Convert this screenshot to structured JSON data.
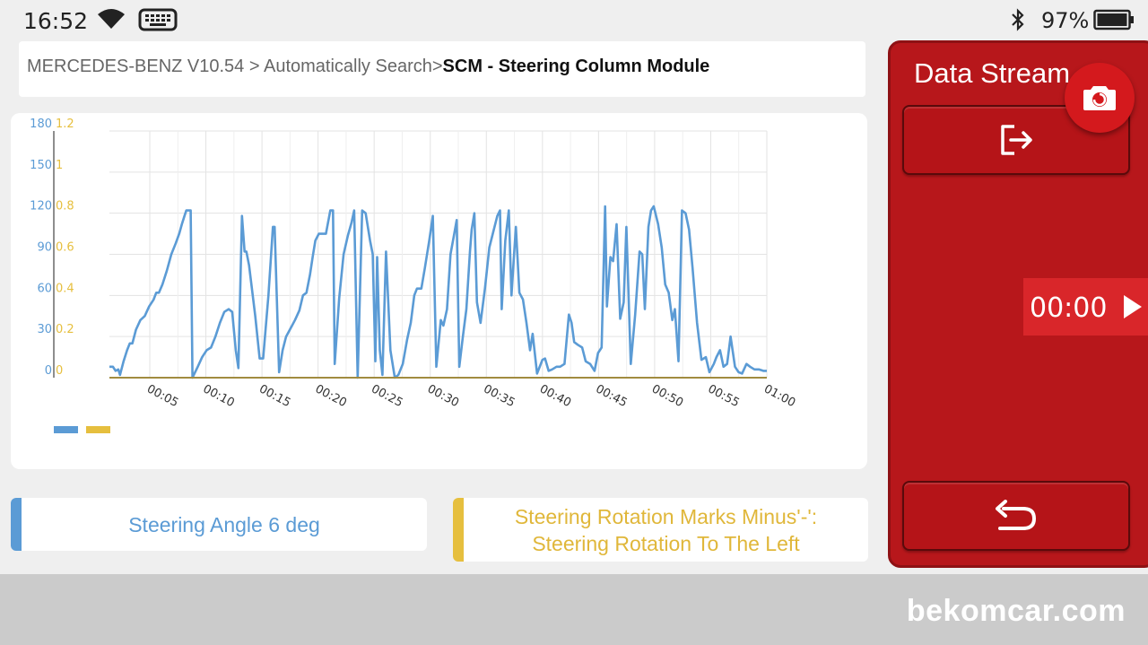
{
  "status_bar": {
    "time": "16:52",
    "battery": "97%",
    "icons": [
      "wifi-icon",
      "keyboard-icon",
      "bluetooth-icon",
      "battery-icon"
    ]
  },
  "breadcrumb": {
    "path": "MERCEDES-BENZ V10.54 > Automatically Search>",
    "current": "SCM - Steering Column Module"
  },
  "chart_data": {
    "type": "line",
    "x_tick_labels": [
      "00:05",
      "00:10",
      "00:15",
      "00:20",
      "00:25",
      "00:30",
      "00:35",
      "00:40",
      "00:45",
      "00:50",
      "00:55",
      "01:00"
    ],
    "x_range_seconds": [
      0,
      60
    ],
    "y_left": {
      "ticks": [
        "180",
        "150",
        "120",
        "90",
        "60",
        "30",
        "0"
      ],
      "range": [
        0,
        180
      ],
      "color": "#5b9bd5"
    },
    "y_right": {
      "ticks": [
        "1.2",
        "1",
        "0.8",
        "0.6",
        "0.4",
        "0.2",
        "0"
      ],
      "range": [
        0,
        1.2
      ],
      "color": "#e6bf3e"
    },
    "grid": true,
    "legend_position": "bottom-left",
    "series": [
      {
        "color": "#5b9bd5",
        "axis": "left",
        "points": [
          [
            0,
            8
          ],
          [
            0.4,
            8
          ],
          [
            0.7,
            5
          ],
          [
            1,
            6
          ],
          [
            1.2,
            2
          ],
          [
            1.6,
            12
          ],
          [
            2,
            20
          ],
          [
            2.3,
            25
          ],
          [
            2.6,
            25
          ],
          [
            3,
            35
          ],
          [
            3.5,
            42
          ],
          [
            4,
            45
          ],
          [
            4.5,
            52
          ],
          [
            5,
            57
          ],
          [
            5.3,
            62
          ],
          [
            5.6,
            62
          ],
          [
            6,
            68
          ],
          [
            6.5,
            78
          ],
          [
            7,
            90
          ],
          [
            7.5,
            98
          ],
          [
            7.9,
            105
          ],
          [
            8.2,
            112
          ],
          [
            8.5,
            118
          ],
          [
            8.7,
            122
          ],
          [
            9.2,
            122
          ],
          [
            9.4,
            0
          ],
          [
            10,
            8
          ],
          [
            10.5,
            15
          ],
          [
            11,
            20
          ],
          [
            11.5,
            22
          ],
          [
            12,
            30
          ],
          [
            12.5,
            40
          ],
          [
            13,
            48
          ],
          [
            13.5,
            50
          ],
          [
            13.9,
            48
          ],
          [
            14.3,
            20
          ],
          [
            14.6,
            7
          ],
          [
            15,
            118
          ],
          [
            15.3,
            92
          ],
          [
            15.5,
            92
          ],
          [
            15.8,
            82
          ],
          [
            16.5,
            45
          ],
          [
            17,
            14
          ],
          [
            17.4,
            14
          ],
          [
            18,
            60
          ],
          [
            18.5,
            110
          ],
          [
            18.7,
            110
          ],
          [
            19.2,
            4
          ],
          [
            19.6,
            20
          ],
          [
            20,
            30
          ],
          [
            20.5,
            36
          ],
          [
            21,
            42
          ],
          [
            21.5,
            49
          ],
          [
            21.9,
            60
          ],
          [
            22.3,
            62
          ],
          [
            22.7,
            75
          ],
          [
            23,
            88
          ],
          [
            23.3,
            100
          ],
          [
            23.7,
            105
          ],
          [
            24.2,
            105
          ],
          [
            24.5,
            105
          ],
          [
            25,
            122
          ],
          [
            25.3,
            122
          ],
          [
            25.5,
            10
          ],
          [
            26,
            58
          ],
          [
            26.5,
            90
          ],
          [
            27,
            104
          ],
          [
            27.4,
            113
          ],
          [
            27.7,
            122
          ],
          [
            28.1,
            0
          ],
          [
            28.6,
            122
          ],
          [
            29,
            120
          ],
          [
            29.5,
            100
          ],
          [
            29.8,
            90
          ],
          [
            30.1,
            12
          ],
          [
            30.3,
            88
          ],
          [
            30.6,
            20
          ],
          [
            30.9,
            2
          ],
          [
            31.3,
            92
          ],
          [
            31.8,
            20
          ],
          [
            32.3,
            0
          ],
          [
            32.7,
            2
          ],
          [
            33.2,
            10
          ],
          [
            33.7,
            28
          ],
          [
            34.1,
            40
          ],
          [
            34.5,
            60
          ],
          [
            34.8,
            65
          ],
          [
            35.3,
            65
          ],
          [
            35.7,
            80
          ],
          [
            36.2,
            100
          ],
          [
            36.6,
            118
          ],
          [
            37,
            8
          ],
          [
            37.5,
            42
          ],
          [
            37.8,
            38
          ],
          [
            38.2,
            50
          ],
          [
            38.6,
            90
          ],
          [
            39,
            104
          ],
          [
            39.3,
            115
          ],
          [
            39.6,
            8
          ],
          [
            40,
            30
          ],
          [
            40.4,
            50
          ],
          [
            40.8,
            92
          ],
          [
            41,
            108
          ],
          [
            41.3,
            120
          ],
          [
            41.6,
            55
          ],
          [
            42,
            40
          ],
          [
            42.5,
            65
          ],
          [
            43,
            95
          ],
          [
            43.5,
            108
          ],
          [
            43.9,
            118
          ],
          [
            44.2,
            122
          ],
          [
            44.4,
            50
          ],
          [
            44.8,
            100
          ],
          [
            45.2,
            122
          ],
          [
            45.5,
            60
          ],
          [
            45.8,
            90
          ],
          [
            46,
            110
          ],
          [
            46.4,
            62
          ],
          [
            46.8,
            57
          ],
          [
            47.2,
            40
          ],
          [
            47.6,
            20
          ],
          [
            47.9,
            32
          ],
          [
            48.4,
            3
          ],
          [
            49,
            13
          ],
          [
            49.3,
            14
          ],
          [
            49.7,
            5
          ],
          [
            50.1,
            6
          ],
          [
            50.6,
            8
          ],
          [
            51,
            8
          ],
          [
            51.5,
            10
          ],
          [
            52,
            46
          ],
          [
            52.3,
            40
          ],
          [
            52.6,
            26
          ],
          [
            53,
            24
          ],
          [
            53.5,
            22
          ],
          [
            53.9,
            12
          ],
          [
            54.4,
            10
          ],
          [
            54.9,
            5
          ],
          [
            55.3,
            18
          ],
          [
            55.7,
            22
          ],
          [
            56.1,
            125
          ],
          [
            56.3,
            52
          ],
          [
            56.7,
            88
          ],
          [
            57,
            85
          ],
          [
            57.4,
            112
          ],
          [
            57.8,
            43
          ],
          [
            58.2,
            55
          ],
          [
            58.5,
            110
          ],
          [
            59,
            10
          ],
          [
            59.5,
            46
          ],
          [
            60,
            92
          ],
          [
            60.3,
            90
          ],
          [
            60.6,
            50
          ],
          [
            61,
            110
          ],
          [
            61.3,
            122
          ],
          [
            61.6,
            125
          ],
          [
            62.1,
            112
          ],
          [
            62.5,
            95
          ],
          [
            62.9,
            68
          ],
          [
            63.3,
            62
          ],
          [
            63.7,
            42
          ],
          [
            64,
            50
          ],
          [
            64.4,
            12
          ],
          [
            64.8,
            122
          ],
          [
            65.2,
            120
          ],
          [
            65.6,
            108
          ],
          [
            66,
            80
          ],
          [
            66.5,
            40
          ],
          [
            67,
            13
          ],
          [
            67.5,
            15
          ],
          [
            67.9,
            4
          ],
          [
            68.4,
            10
          ],
          [
            68.7,
            15
          ],
          [
            69.1,
            20
          ],
          [
            69.5,
            8
          ],
          [
            69.9,
            10
          ],
          [
            70.3,
            30
          ],
          [
            70.8,
            8
          ],
          [
            71.2,
            4
          ],
          [
            71.6,
            3
          ],
          [
            72.1,
            10
          ],
          [
            72.5,
            8
          ],
          [
            73,
            6
          ],
          [
            73.5,
            6
          ],
          [
            74,
            5
          ],
          [
            74.4,
            5
          ]
        ],
        "x_scale_note": ""
      },
      {
        "color": "#e6bf3e",
        "axis": "right",
        "points": [
          [
            0,
            0
          ],
          [
            74.4,
            0
          ]
        ]
      }
    ]
  },
  "value_cards": [
    {
      "text": "Steering Angle 6 deg",
      "color": "#5b9bd5"
    },
    {
      "text": "Steering Rotation Marks Minus'-':\n Steering Rotation To The Left",
      "color": "#e6bf3e"
    }
  ],
  "side_panel": {
    "title": "Data Stream",
    "timer": "00:00",
    "icons": [
      "exit-icon",
      "camera-icon",
      "play-icon",
      "back-icon"
    ]
  },
  "watermark": "bekomcar.com"
}
